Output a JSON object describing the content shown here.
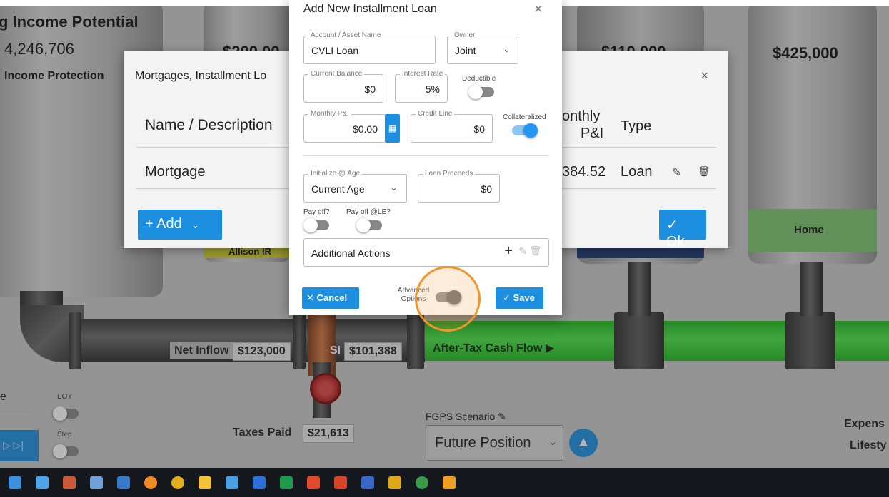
{
  "background": {
    "income_title": "g Income Potential",
    "income_value": "4,246,706",
    "income_protection": "Income Protection",
    "tank_values": [
      "$200,00",
      "$110,000",
      "$425,000"
    ],
    "home_label": "Home",
    "allison_label": "Allison IR",
    "net_inflow_label": "Net Inflow",
    "net_inflow_value": "$123,000",
    "si_label": "SI",
    "si_value": "$101,388",
    "after_tax_label": "After-Tax Cash Flow ▶",
    "taxes_paid_label": "Taxes Paid",
    "taxes_paid_value": "$21,613",
    "eoy_label": "EOY",
    "step_label": "Step",
    "e_label": "e",
    "fgps_label": "FGPS Scenario",
    "fgps_value": "Future Position",
    "expense_label": "Expens",
    "lifesty_label": "Lifesty"
  },
  "mortgage_panel": {
    "title": "Mortgages, Installment Lo",
    "col_name": "Name / Description",
    "col_monthly_1": "onthly",
    "col_monthly_2": "P&I",
    "col_type": "Type",
    "row_name": "Mortgage",
    "row_monthly": "384.52",
    "row_type": "Loan",
    "add_label": "+ Add",
    "ok_label": "✓ Ok"
  },
  "modal": {
    "title": "Add New Installment Loan",
    "close": "×",
    "account_label": "Account / Asset Name",
    "account_value": "CVLI Loan",
    "owner_label": "Owner",
    "owner_value": "Joint",
    "balance_label": "Current Balance",
    "balance_value": "$0",
    "rate_label": "Interest Rate",
    "rate_value": "5%",
    "deductible_label": "Deductible",
    "monthly_label": "Monthly P&I",
    "monthly_value": "$0.00",
    "credit_label": "Credit Line",
    "credit_value": "$0",
    "collateralized_label": "Collateralized",
    "init_label": "Initialize @ Age",
    "init_value": "Current Age",
    "proceeds_label": "Loan Proceeds",
    "proceeds_value": "$0",
    "payoff_label": "Pay off?",
    "payoff_le_label": "Pay off @LE?",
    "additional_label": "Additional Actions",
    "cancel_label": "✕ Cancel",
    "advanced_label": "Advanced Options",
    "save_label": "✓ Save"
  },
  "colors": {
    "accent": "#1d8fe0",
    "green_pipe": "#33d133",
    "highlight": "#f0962a"
  },
  "taskbar_icons": [
    "file-explorer-icon",
    "photos-icon",
    "paint-icon",
    "calculator-icon",
    "notepad-icon",
    "firefox-icon",
    "chrome-icon",
    "folder-icon",
    "settings-icon",
    "word-icon",
    "excel-icon",
    "pdf-icon",
    "zoom-icon",
    "teams-icon",
    "app-icon",
    "chrome-profile-icon",
    "vlc-icon"
  ]
}
